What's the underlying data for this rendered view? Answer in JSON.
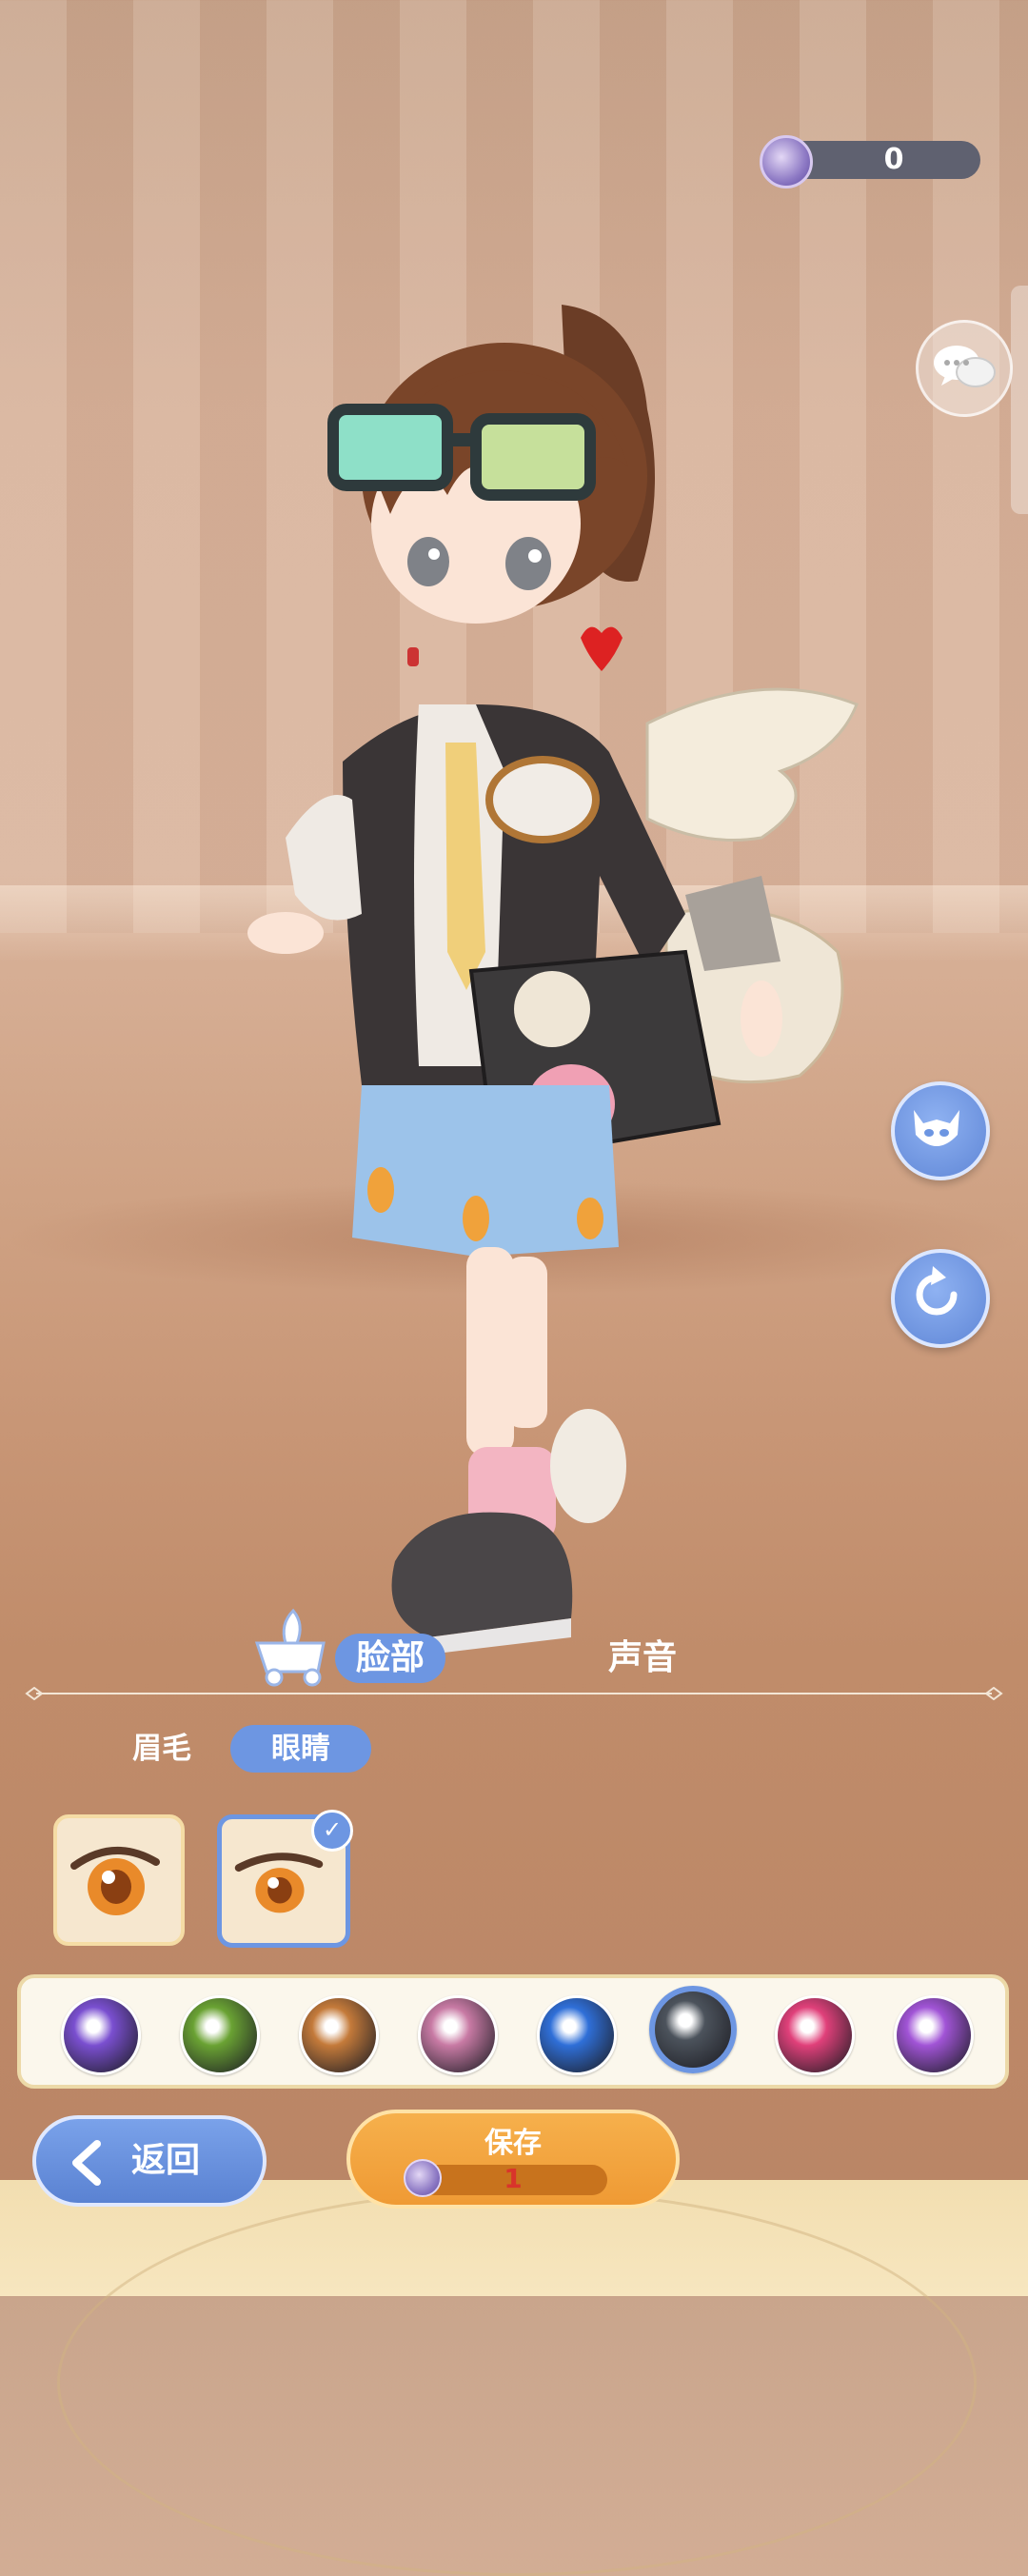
{
  "currency": {
    "amount": "0",
    "icon": "crystal-coin-icon"
  },
  "side_buttons": [
    "chat-icon",
    "face-mask-icon",
    "reset-rotate-icon"
  ],
  "tabs": [
    {
      "label": "脸部",
      "active": true
    },
    {
      "label": "声音",
      "active": false
    }
  ],
  "subtabs": [
    {
      "label": "眉毛",
      "active": false
    },
    {
      "label": "眼睛",
      "active": true
    }
  ],
  "eye_styles": [
    {
      "selected": false
    },
    {
      "selected": true
    }
  ],
  "eye_colors": [
    {
      "color": "#7a4fd0",
      "selected": false
    },
    {
      "color": "#6aa233",
      "selected": false
    },
    {
      "color": "#c47a3a",
      "selected": false
    },
    {
      "color": "#c87aa4",
      "selected": false
    },
    {
      "color": "#2f6fd8",
      "selected": false
    },
    {
      "color": "#4c535c",
      "selected": true
    },
    {
      "color": "#e0407a",
      "selected": false
    },
    {
      "color": "#a154d6",
      "selected": false
    }
  ],
  "buttons": {
    "back_label": "返回",
    "save_label": "保存",
    "save_cost": "1"
  },
  "colors": {
    "accent": "#6d96e2",
    "save": "#f2a23c",
    "cost_text": "#d9342b"
  }
}
